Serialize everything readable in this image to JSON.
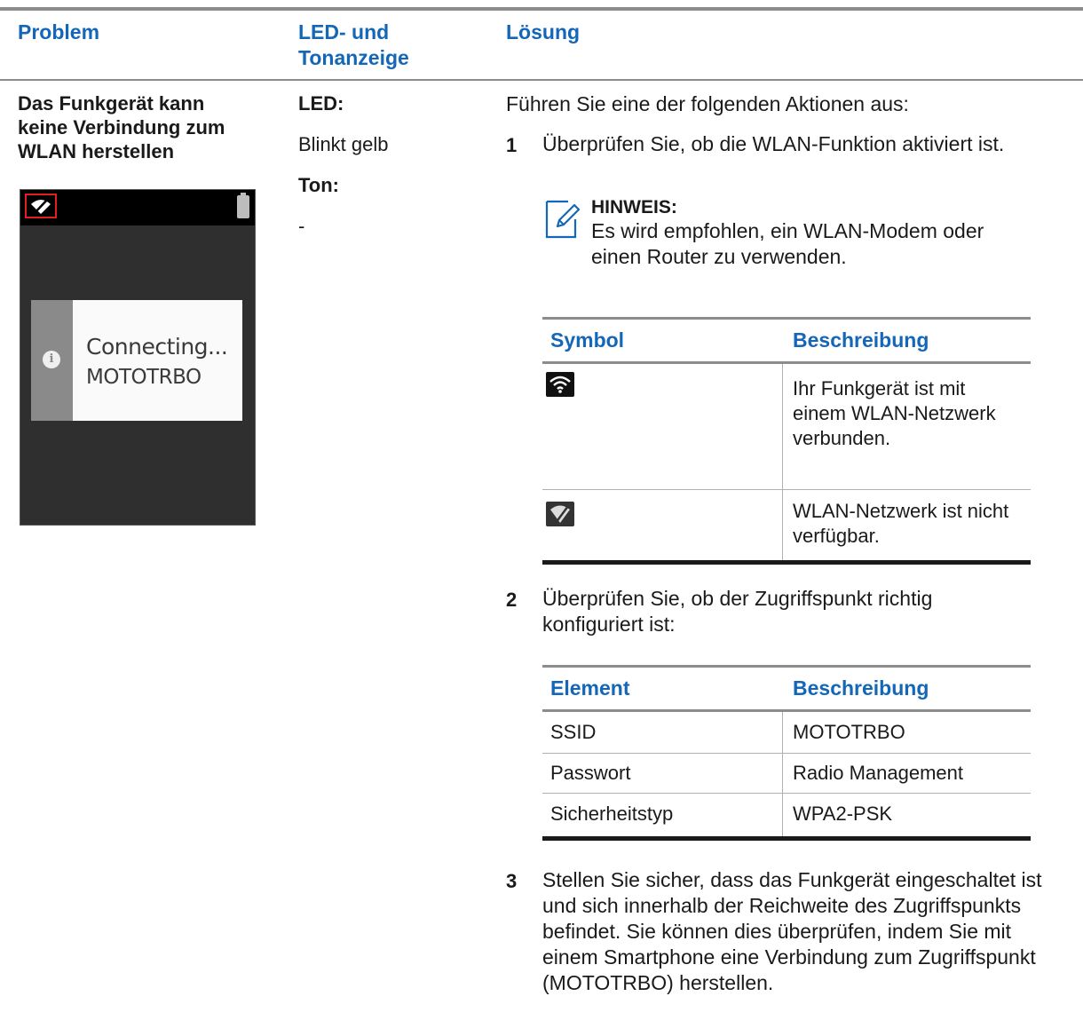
{
  "header": {
    "problem": "Problem",
    "led_ton": "LED- und Tonanzeige",
    "loesung": "Lösung"
  },
  "problem": {
    "text": "Das Funkgerät kann keine Verbindung zum WLAN herstellen",
    "screen": {
      "line1": "Connecting...",
      "line2": "MOTOTRBO",
      "highlight_color": "#e02020",
      "icons": [
        "wifi-off-icon",
        "battery-icon",
        "info-icon"
      ]
    }
  },
  "led": {
    "led_label": "LED:",
    "led_value": "Blinkt gelb",
    "ton_label": "Ton:",
    "ton_value": "-"
  },
  "solution": {
    "intro": "Führen Sie eine der folgenden Aktionen aus:",
    "steps": [
      {
        "num": "1",
        "text": "Überprüfen Sie, ob die WLAN-Funktion aktiviert ist."
      },
      {
        "num": "2",
        "text": "Überprüfen Sie, ob der Zugriffspunkt richtig konfiguriert ist:"
      },
      {
        "num": "3",
        "text": "Stellen Sie sicher, dass das Funkgerät eingeschaltet ist und sich innerhalb der Reichweite des Zugriffspunkts befindet. Sie können dies überprüfen, indem Sie mit einem Smartphone eine Verbindung zum Zugriffspunkt (MOTOTRBO) herstellen."
      }
    ],
    "note": {
      "title": "HINWEIS:",
      "text": "Es wird empfohlen, ein WLAN-Modem oder einen Router zu verwenden."
    },
    "symbol_table": {
      "headers": [
        "Symbol",
        "Beschreibung"
      ],
      "rows": [
        {
          "icon": "wifi-connected-icon",
          "desc": "Ihr Funkgerät ist mit einem WLAN-Netzwerk verbunden."
        },
        {
          "icon": "wifi-unavailable-icon",
          "desc": "WLAN-Netzwerk ist nicht verfügbar."
        }
      ]
    },
    "config_table": {
      "headers": [
        "Element",
        "Beschreibung"
      ],
      "rows": [
        [
          "SSID",
          "MOTOTRBO"
        ],
        [
          "Passwort",
          "Radio Management"
        ],
        [
          "Sicherheitstyp",
          "WPA2-PSK"
        ]
      ]
    }
  },
  "colors": {
    "heading": "#1467b8",
    "rule": "#8c8c8c"
  }
}
